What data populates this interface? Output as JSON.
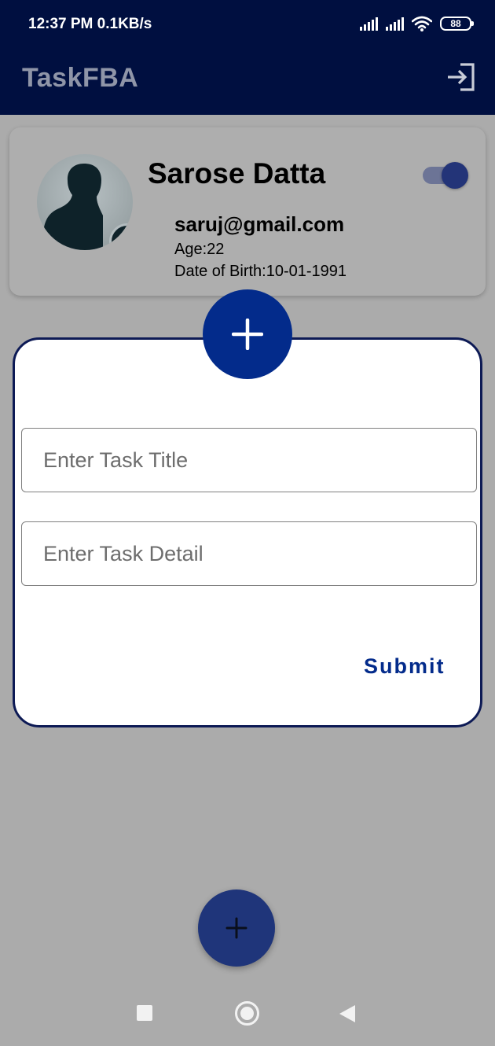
{
  "status_bar": {
    "time_speed": "12:37 PM  0.1KB/s",
    "battery": "88",
    "icons": [
      "signal-icon",
      "signal-icon",
      "wifi-icon",
      "battery-icon"
    ]
  },
  "app_bar": {
    "title": "TaskFBA",
    "action_icon": "logout-icon"
  },
  "profile": {
    "name": "Sarose Datta",
    "email": "saruj@gmail.com",
    "age": "Age:22",
    "dob": "Date of Birth:10-01-1991",
    "avatar_icon": "user-lock-icon",
    "toggle_on": true
  },
  "dialog": {
    "header_icon": "plus-icon",
    "title_placeholder": "Enter Task Title",
    "detail_placeholder": "Enter Task Detail",
    "submit_label": "Submit"
  },
  "fab": {
    "icon": "plus-icon"
  },
  "nav_bar": {
    "icons": [
      "recent-apps-icon",
      "home-icon",
      "back-icon"
    ]
  },
  "colors": {
    "primary": "#000f40",
    "accent": "#032b8b",
    "scrim_background": "#ababab",
    "fab": "#1f357a"
  }
}
